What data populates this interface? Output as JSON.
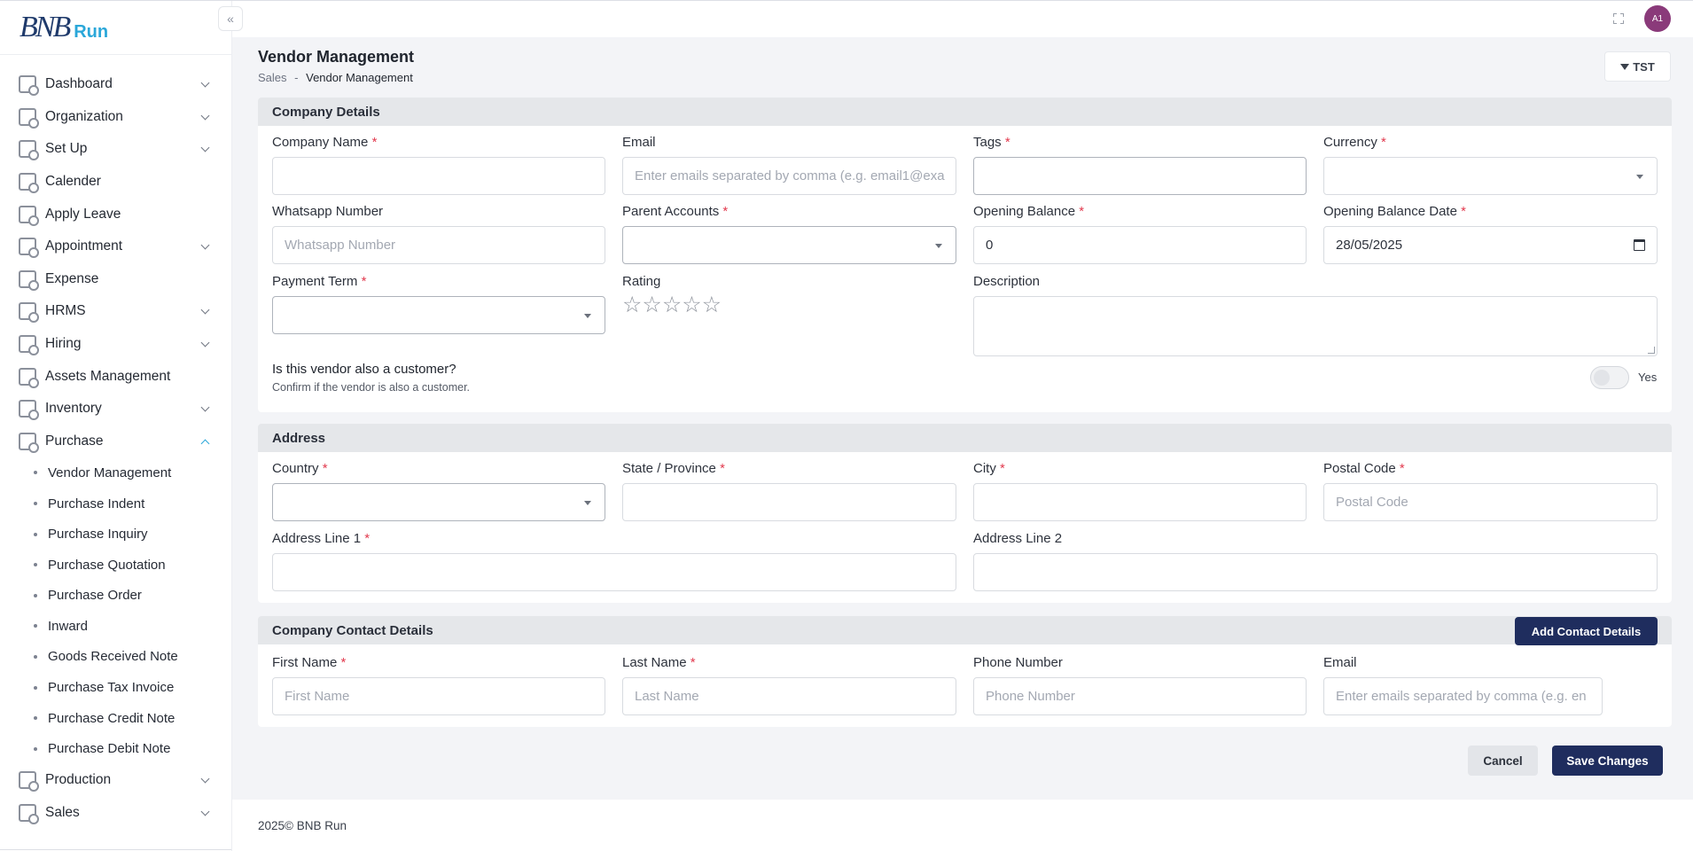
{
  "app": {
    "logo_text": "BNB",
    "logo_sub": "Run"
  },
  "sidebar": {
    "items": [
      {
        "label": "Dashboard",
        "icon": "dashboard-icon",
        "has_children": true
      },
      {
        "label": "Organization",
        "icon": "organization-icon",
        "has_children": true
      },
      {
        "label": "Set Up",
        "icon": "setup-icon",
        "has_children": true
      },
      {
        "label": "Calender",
        "icon": "calendar-icon",
        "has_children": false
      },
      {
        "label": "Apply Leave",
        "icon": "leave-icon",
        "has_children": false
      },
      {
        "label": "Appointment",
        "icon": "appointment-icon",
        "has_children": true
      },
      {
        "label": "Expense",
        "icon": "expense-icon",
        "has_children": false
      },
      {
        "label": "HRMS",
        "icon": "hrms-icon",
        "has_children": true
      },
      {
        "label": "Hiring",
        "icon": "hiring-icon",
        "has_children": true
      },
      {
        "label": "Assets Management",
        "icon": "assets-icon",
        "has_children": false
      },
      {
        "label": "Inventory",
        "icon": "inventory-icon",
        "has_children": true
      },
      {
        "label": "Purchase",
        "icon": "purchase-cart-icon",
        "has_children": true,
        "expanded": true
      }
    ],
    "purchase_sub": [
      "Vendor Management",
      "Purchase Indent",
      "Purchase Inquiry",
      "Purchase Quotation",
      "Purchase Order",
      "Inward",
      "Goods Received Note",
      "Purchase Tax Invoice",
      "Purchase Credit Note",
      "Purchase Debit Note"
    ],
    "after": [
      {
        "label": "Production",
        "icon": "production-icon",
        "has_children": true
      },
      {
        "label": "Sales",
        "icon": "sales-icon",
        "has_children": true
      }
    ]
  },
  "topbar": {
    "avatar_initials": "A1"
  },
  "header": {
    "title": "Vendor Management",
    "breadcrumb_root": "Sales",
    "breadcrumb_sep": "-",
    "breadcrumb_current": "Vendor Management",
    "filter_label": "TST"
  },
  "company": {
    "section_title": "Company Details",
    "company_name": {
      "label": "Company Name",
      "value": "",
      "placeholder": ""
    },
    "email": {
      "label": "Email",
      "placeholder": "Enter emails separated by comma (e.g. email1@exa"
    },
    "tags": {
      "label": "Tags",
      "value": ""
    },
    "currency": {
      "label": "Currency",
      "value": ""
    },
    "whatsapp": {
      "label": "Whatsapp Number",
      "placeholder": "Whatsapp Number"
    },
    "parent_accounts": {
      "label": "Parent Accounts",
      "value": ""
    },
    "opening_balance": {
      "label": "Opening Balance",
      "value": "0"
    },
    "opening_balance_date": {
      "label": "Opening Balance Date",
      "value": "28/05/2025"
    },
    "payment_term": {
      "label": "Payment Term",
      "value": ""
    },
    "rating": {
      "label": "Rating",
      "stars": "☆☆☆☆☆",
      "value": 0,
      "max": 5
    },
    "description": {
      "label": "Description",
      "value": ""
    },
    "customer_question": "Is this vendor also a customer?",
    "customer_hint": "Confirm if the vendor is also a customer.",
    "customer_toggle_label": "Yes",
    "customer_toggle_on": false
  },
  "address": {
    "section_title": "Address",
    "country": {
      "label": "Country",
      "value": ""
    },
    "state": {
      "label": "State / Province",
      "value": ""
    },
    "city": {
      "label": "City",
      "value": ""
    },
    "postal": {
      "label": "Postal Code",
      "placeholder": "Postal Code"
    },
    "line1": {
      "label": "Address Line 1",
      "value": ""
    },
    "line2": {
      "label": "Address Line 2",
      "value": ""
    }
  },
  "contact": {
    "section_title": "Company Contact Details",
    "add_label": "Add Contact Details",
    "first_name": {
      "label": "First Name",
      "placeholder": "First Name"
    },
    "last_name": {
      "label": "Last Name",
      "placeholder": "Last Name"
    },
    "phone": {
      "label": "Phone Number",
      "placeholder": "Phone Number"
    },
    "email": {
      "label": "Email",
      "placeholder": "Enter emails separated by comma (e.g. en"
    }
  },
  "actions": {
    "cancel": "Cancel",
    "save": "Save Changes"
  },
  "footer": {
    "text": "2025© BNB Run"
  },
  "colors": {
    "primary": "#1f2d5e",
    "accent": "#2aa7d9",
    "required": "#e23a4e"
  }
}
